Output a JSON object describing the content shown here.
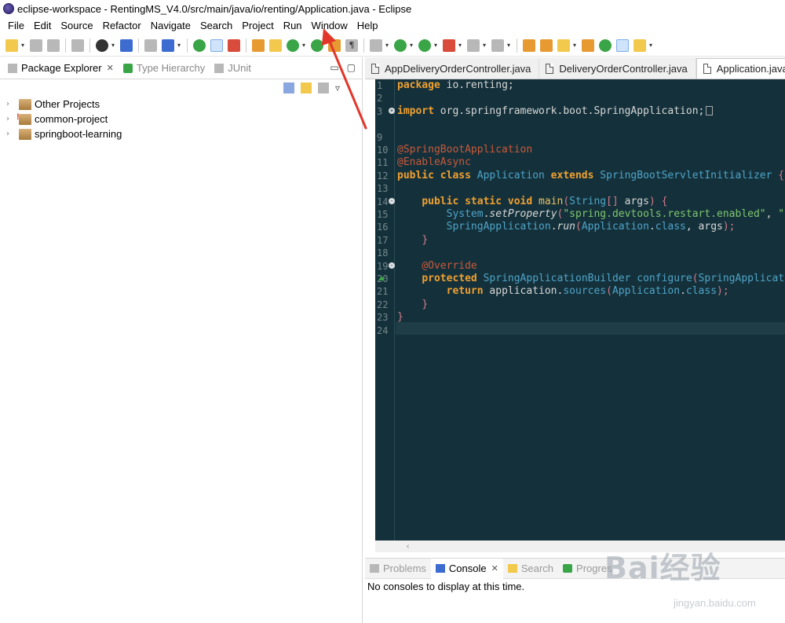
{
  "window": {
    "title": "eclipse-workspace - RentingMS_V4.0/src/main/java/io/renting/Application.java - Eclipse"
  },
  "menu": [
    {
      "label": "File"
    },
    {
      "label": "Edit"
    },
    {
      "label": "Source"
    },
    {
      "label": "Refactor"
    },
    {
      "label": "Navigate"
    },
    {
      "label": "Search"
    },
    {
      "label": "Project"
    },
    {
      "label": "Run"
    },
    {
      "label": "Window"
    },
    {
      "label": "Help"
    }
  ],
  "left_panel": {
    "tabs": [
      {
        "label": "Package Explorer",
        "icon": "package-explorer-icon",
        "active": true
      },
      {
        "label": "Type Hierarchy",
        "icon": "hierarchy-icon",
        "active": false
      },
      {
        "label": "JUnit",
        "icon": "junit-icon",
        "active": false
      }
    ],
    "tree": [
      {
        "label": "Other Projects",
        "icon": "working-set-icon"
      },
      {
        "label": "common-project",
        "icon": "project-error-icon"
      },
      {
        "label": "springboot-learning",
        "icon": "working-set-icon"
      }
    ]
  },
  "editor": {
    "tabs": [
      {
        "label": "AppDeliveryOrderController.java",
        "active": false
      },
      {
        "label": "DeliveryOrderController.java",
        "active": false
      },
      {
        "label": "Application.java",
        "active": true
      }
    ],
    "line_numbers": [
      "1",
      "2",
      "3",
      "9",
      "10",
      "11",
      "12",
      "13",
      "14",
      "15",
      "16",
      "17",
      "18",
      "19",
      "20",
      "21",
      "22",
      "23",
      "24"
    ],
    "colors": {
      "background": "#14313b",
      "keyword": "#f0a030",
      "annotation": "#c8583a",
      "type": "#4fa3c7",
      "string": "#7fc56c"
    }
  },
  "console": {
    "tabs": [
      {
        "label": "Problems",
        "active": false
      },
      {
        "label": "Console",
        "active": true
      },
      {
        "label": "Search",
        "active": false
      },
      {
        "label": "Progres",
        "active": false
      }
    ],
    "message": "No consoles to display at this time."
  },
  "watermark": {
    "brand": "Bai经验",
    "url": "jingyan.baidu.com"
  }
}
